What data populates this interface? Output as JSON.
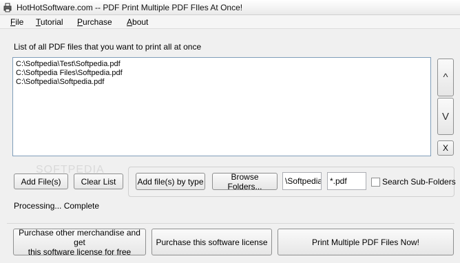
{
  "window": {
    "title": "HotHotSoftware.com -- PDF Print Multiple PDF FIles At Once!"
  },
  "menu": [
    "File",
    "Tutorial",
    "Purchase",
    "About"
  ],
  "list": {
    "label": "List of all PDF files that you want to print all at once",
    "files": [
      "C:\\Softpedia\\Test\\Softpedia.pdf",
      "C:\\Softpedia Files\\Softpedia.pdf",
      "C:\\Softpedia\\Softpedia.pdf"
    ]
  },
  "side_buttons": {
    "up": "^",
    "down": "V",
    "remove": "X"
  },
  "buttons": {
    "add_files": "Add File(s)",
    "clear_list": "Clear List",
    "add_by_type": "Add file(s) by type",
    "browse_folders": "Browse Folders...",
    "purchase_merch_line1": "Purchase other merchandise and get",
    "purchase_merch_line2": "this software license for free",
    "purchase_license": "Purchase this software license",
    "print": "Print Multiple PDF Files Now!"
  },
  "fields": {
    "folder": "\\Softpedia",
    "pattern": "*.pdf"
  },
  "search_subfolders": {
    "label": "Search Sub-Folders",
    "checked": false
  },
  "status": "Processing... Complete",
  "watermark": "SOFTPEDIA"
}
